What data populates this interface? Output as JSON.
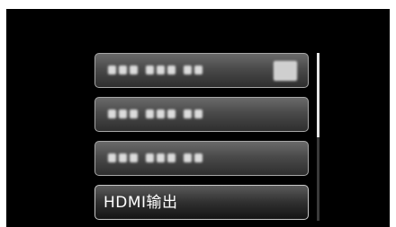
{
  "menu": {
    "items": [
      {
        "label": "",
        "blurred": true,
        "has_badge": true
      },
      {
        "label": "",
        "blurred": true,
        "has_badge": false
      },
      {
        "label": "",
        "blurred": true,
        "has_badge": false
      },
      {
        "label": "HDMI输出",
        "blurred": false,
        "selected": true
      }
    ]
  },
  "scrollbar": {
    "position_fraction": 0.0,
    "visible_fraction": 0.5
  },
  "colors": {
    "background": "#000000",
    "item_border": "#a8a8a8",
    "text": "#ffffff"
  }
}
